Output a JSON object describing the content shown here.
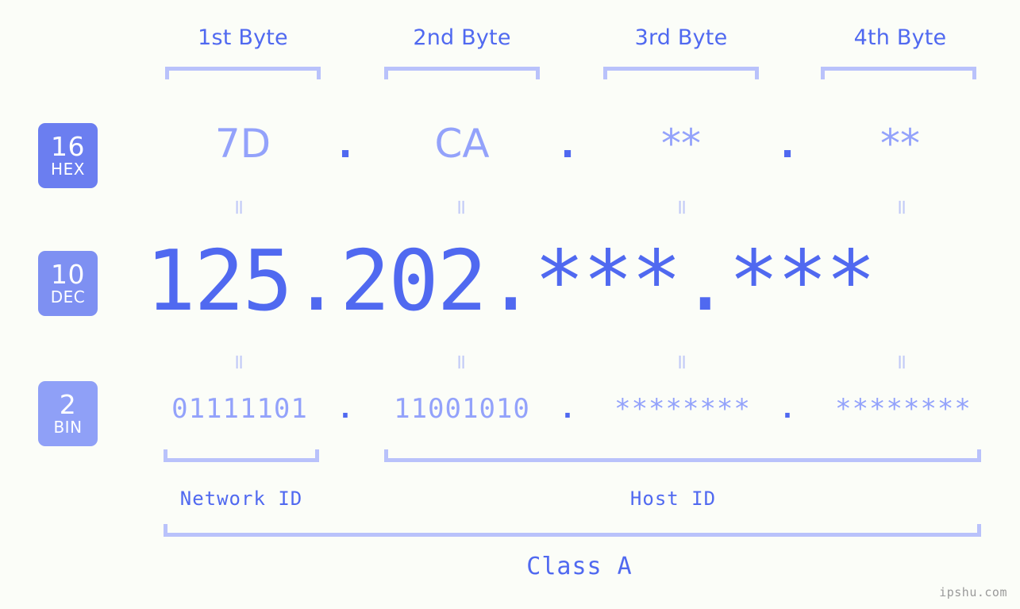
{
  "page": {
    "background": "#fbfdf8",
    "accent": "#5069f0",
    "accent_light": "#93a2fb",
    "accent_pale": "#b9c2fb",
    "watermark": "ipshu.com"
  },
  "byte_headers": [
    {
      "label": "1st Byte"
    },
    {
      "label": "2nd Byte"
    },
    {
      "label": "3rd Byte"
    },
    {
      "label": "4th Byte"
    }
  ],
  "rows": [
    {
      "badge_base": "16",
      "badge_name": "HEX",
      "badge_color": "#6b7ef0",
      "values": [
        "7D",
        "CA",
        "**",
        "**"
      ],
      "separator": "."
    },
    {
      "badge_base": "10",
      "badge_name": "DEC",
      "badge_color": "#7e90f2",
      "values": [
        "125",
        "202",
        "***",
        "***"
      ],
      "separator": "."
    },
    {
      "badge_base": "2",
      "badge_name": "BIN",
      "badge_color": "#8fa0f7",
      "values": [
        "01111101",
        "11001010",
        "********",
        "********"
      ],
      "separator": "."
    }
  ],
  "equals_marks": {
    "glyph": "=",
    "count_per_row": 4
  },
  "id_sections": [
    {
      "label": "Network ID"
    },
    {
      "label": "Host ID"
    }
  ],
  "class_section": {
    "label": "Class A"
  }
}
